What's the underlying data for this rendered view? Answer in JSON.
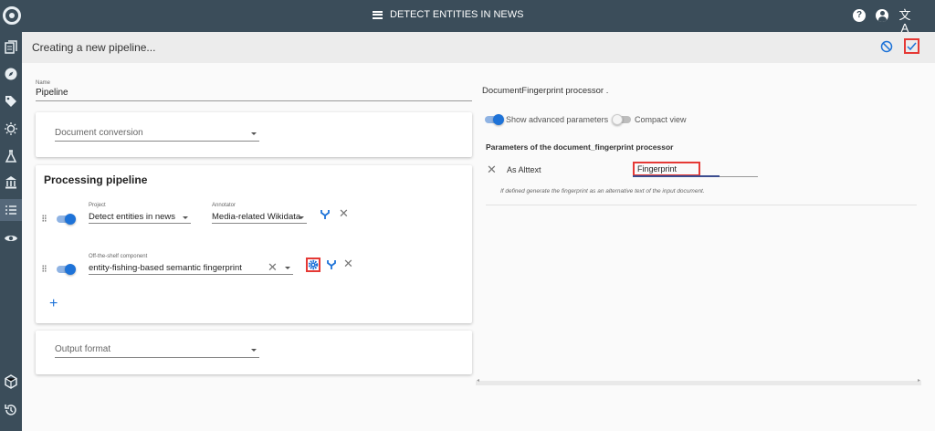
{
  "topbar": {
    "title": "DETECT ENTITIES IN NEWS",
    "help_glyph": "?",
    "translate_glyph": "文A",
    "icons": [
      "app-logo-icon",
      "menu-icon",
      "help-icon",
      "account-icon",
      "translate-icon"
    ]
  },
  "sidebar": {
    "items": [
      "documents-icon",
      "explore-icon",
      "tags-icon",
      "ideas-icon",
      "lab-icon",
      "bank-icon",
      "pipelines-icon",
      "eye-icon",
      "cube-icon",
      "history-icon"
    ],
    "active": "pipelines-icon"
  },
  "subheader": {
    "title": "Creating a new pipeline...",
    "icons": [
      "cancel-icon",
      "check-icon"
    ]
  },
  "name_field": {
    "label": "Name",
    "value": "Pipeline"
  },
  "document_conversion": {
    "placeholder": "Document conversion"
  },
  "processing_pipeline": {
    "title": "Processing pipeline",
    "steps": [
      {
        "enabled": true,
        "project_label": "Project",
        "project_value": "Detect entities in news",
        "annotator_label": "Annotator",
        "annotator_value": "Media-related Wikidata"
      },
      {
        "enabled": true,
        "component_label": "Off-the-shelf component",
        "component_value": "entity-fishing-based semantic fingerprint"
      }
    ],
    "add_glyph": "+"
  },
  "output_format": {
    "placeholder": "Output format"
  },
  "processor_panel": {
    "heading": "DocumentFingerprint processor .",
    "show_advanced_label": "Show advanced parameters",
    "show_advanced_on": true,
    "compact_view_label": "Compact view",
    "compact_view_on": false,
    "params_title": "Parameters of the document_fingerprint processor",
    "param": {
      "label": "As Alttext",
      "value": "Fingerprint",
      "hint": "If defined generate the fingerprint as an alternative text of the input document."
    }
  },
  "colors": {
    "topbar": "#3b4d5a",
    "accent": "#1e73d8",
    "highlight": "#e53935"
  }
}
